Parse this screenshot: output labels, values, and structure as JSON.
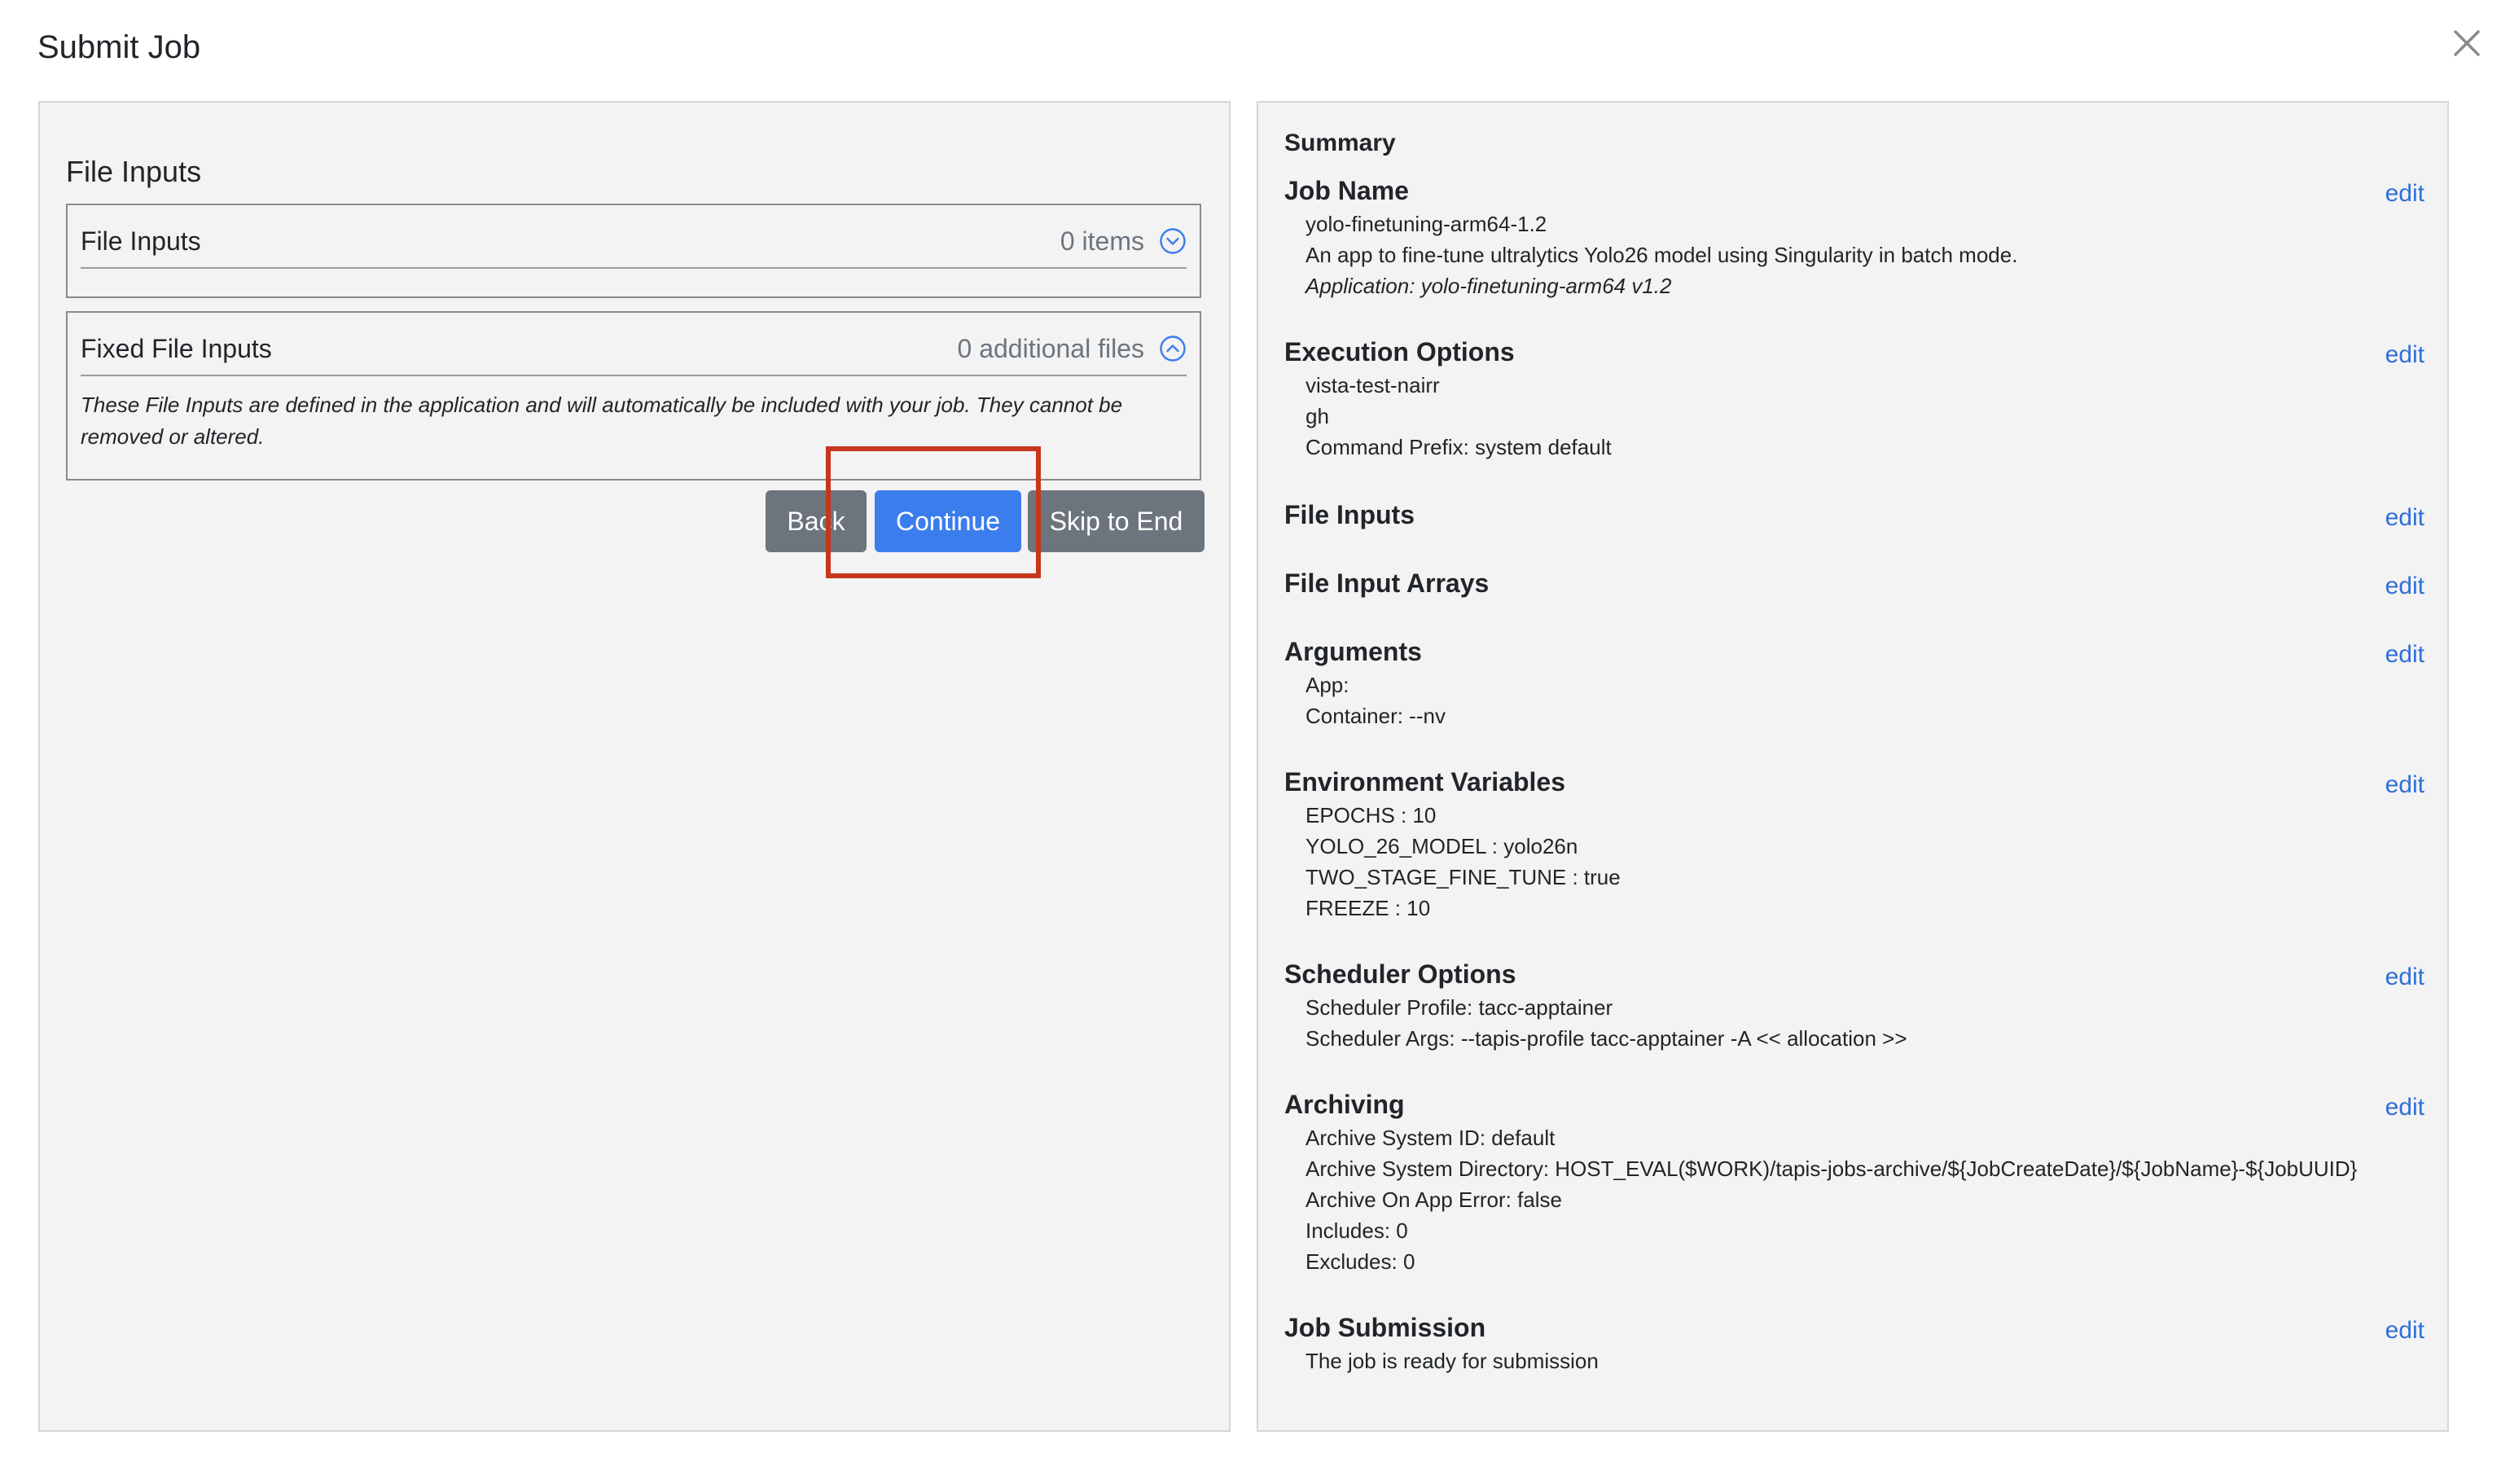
{
  "modal": {
    "title": "Submit Job"
  },
  "left": {
    "heading": "File Inputs",
    "file_inputs": {
      "title": "File Inputs",
      "count": "0 items"
    },
    "fixed_file_inputs": {
      "title": "Fixed File Inputs",
      "count": "0 additional files",
      "description": "These File Inputs are defined in the application and will automatically be included with your job. They cannot be removed or altered."
    },
    "buttons": {
      "back": "Back",
      "continue": "Continue",
      "skip": "Skip to End"
    }
  },
  "summary": {
    "title": "Summary",
    "edit_label": "edit",
    "job_name": {
      "title": "Job Name",
      "name": "yolo-finetuning-arm64-1.2",
      "description": "An app to fine-tune ultralytics Yolo26 model using Singularity in batch mode.",
      "application": "Application: yolo-finetuning-arm64 v1.2"
    },
    "execution_options": {
      "title": "Execution Options",
      "lines": [
        "vista-test-nairr",
        "gh",
        "Command Prefix: system default"
      ]
    },
    "file_inputs": {
      "title": "File Inputs"
    },
    "file_input_arrays": {
      "title": "File Input Arrays"
    },
    "arguments": {
      "title": "Arguments",
      "lines": [
        "App:",
        "Container: --nv"
      ]
    },
    "environment_variables": {
      "title": "Environment Variables",
      "lines": [
        "EPOCHS : 10",
        "YOLO_26_MODEL : yolo26n",
        "TWO_STAGE_FINE_TUNE : true",
        "FREEZE : 10"
      ]
    },
    "scheduler_options": {
      "title": "Scheduler Options",
      "lines": [
        "Scheduler Profile: tacc-apptainer",
        "Scheduler Args: --tapis-profile tacc-apptainer -A << allocation >>"
      ]
    },
    "archiving": {
      "title": "Archiving",
      "lines": [
        "Archive System ID: default",
        "Archive System Directory: HOST_EVAL($WORK)/tapis-jobs-archive/${JobCreateDate}/${JobName}-${JobUUID}",
        "Archive On App Error: false",
        "Includes: 0",
        "Excludes: 0"
      ]
    },
    "job_submission": {
      "title": "Job Submission",
      "lines": [
        "The job is ready for submission"
      ]
    }
  },
  "colors": {
    "primary": "#3b7ded",
    "secondary": "#6c757d",
    "link": "#2f6fd8",
    "highlight": "#c8361c"
  }
}
